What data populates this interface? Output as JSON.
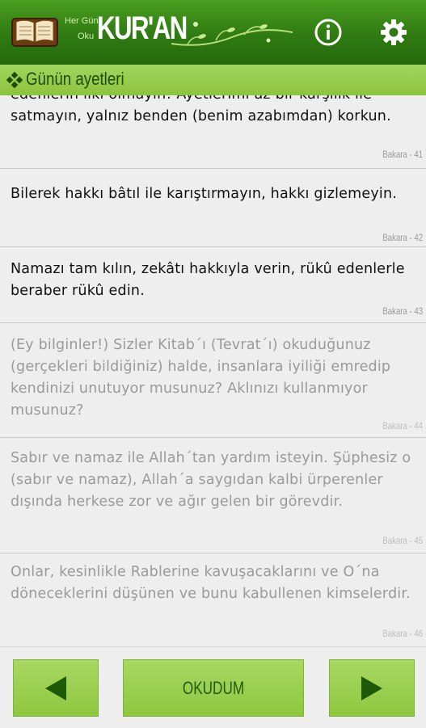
{
  "header": {
    "logo_line1": "Her Gün",
    "logo_line2": "Oku",
    "logo_title": "KUR'AN",
    "info_icon": "info-icon",
    "settings_icon": "gear-icon"
  },
  "section": {
    "title": "Günün ayetleri",
    "icon": "diamond-cluster-icon"
  },
  "verses": [
    {
      "text": "edenlerin ilki olmayın! Ayetlerimi az bir karşılık ile satmayın, yalnız benden (benim azabımdan) korkun.",
      "ref": "Bakara - 41"
    },
    {
      "text": "Bilerek hakkı bâtıl ile karıştırmayın, hakkı gizlemeyin.",
      "ref": "Bakara - 42"
    },
    {
      "text": "Namazı tam kılın, zekâtı hakkıyla verin, rükû edenlerle beraber rükû edin.",
      "ref": "Bakara - 43"
    },
    {
      "text": "(Ey bilginler!) Sizler Kitab´ı (Tevrat´ı) okuduğunuz (gerçekleri bildiğiniz) halde, insanlara iyiliği emredip kendinizi unutuyor musunuz? Aklınızı kullanmıyor musunuz?",
      "ref": "Bakara - 44"
    },
    {
      "text": "Sabır ve namaz ile Allah´tan yardım isteyin. Şüphesiz o (sabır ve namaz), Allah´a saygıdan kalbi ürperenler dışında herkese zor ve ağır gelen bir görevdir.",
      "ref": "Bakara - 45"
    },
    {
      "text": "Onlar, kesinlikle Rablerine kavuşacaklarını ve O´na döneceklerini düşünen ve bunu kabullenen kimselerdir.",
      "ref": "Bakara - 46"
    }
  ],
  "nav": {
    "prev_icon": "arrow-left-icon",
    "read_label": "OKUDUM",
    "next_icon": "arrow-right-icon"
  },
  "colors": {
    "header_green": "#2f7a12",
    "section_green": "#97cc4b",
    "button_green": "#9bd052",
    "dark_green_icon": "#1e5a06"
  }
}
